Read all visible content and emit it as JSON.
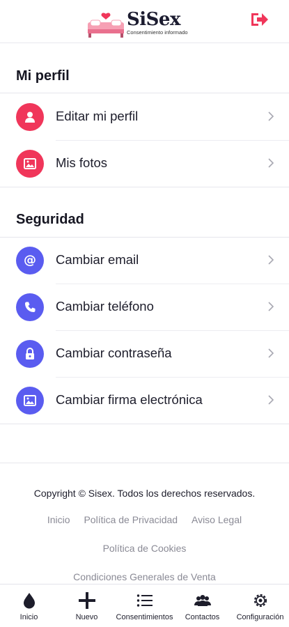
{
  "header": {
    "brand": "SiSex",
    "tagline": "Consentimiento informado"
  },
  "colors": {
    "primary_red": "#f0365a",
    "primary_blue": "#5a5cf0",
    "text_dark": "#1d1d2b",
    "muted": "#8a8a95"
  },
  "profile_section": {
    "title": "Mi perfil",
    "items": [
      {
        "label": "Editar mi perfil",
        "icon": "user-icon"
      },
      {
        "label": "Mis fotos",
        "icon": "image-icon"
      }
    ]
  },
  "security_section": {
    "title": "Seguridad",
    "items": [
      {
        "label": "Cambiar email",
        "icon": "at-icon"
      },
      {
        "label": "Cambiar teléfono",
        "icon": "phone-icon"
      },
      {
        "label": "Cambiar contraseña",
        "icon": "lock-icon"
      },
      {
        "label": "Cambiar firma electrónica",
        "icon": "image-icon"
      }
    ]
  },
  "footer": {
    "copyright": "Copyright © Sisex. Todos los derechos reservados.",
    "links": [
      "Inicio",
      "Política de Privacidad",
      "Aviso Legal",
      "Política de Cookies",
      "Condiciones Generales de Venta"
    ]
  },
  "bottom_nav": {
    "items": [
      {
        "label": "Inicio",
        "icon": "drop-icon"
      },
      {
        "label": "Nuevo",
        "icon": "plus-icon"
      },
      {
        "label": "Consentimientos",
        "icon": "list-icon"
      },
      {
        "label": "Contactos",
        "icon": "contacts-icon"
      },
      {
        "label": "Configuración",
        "icon": "gear-icon"
      }
    ]
  }
}
